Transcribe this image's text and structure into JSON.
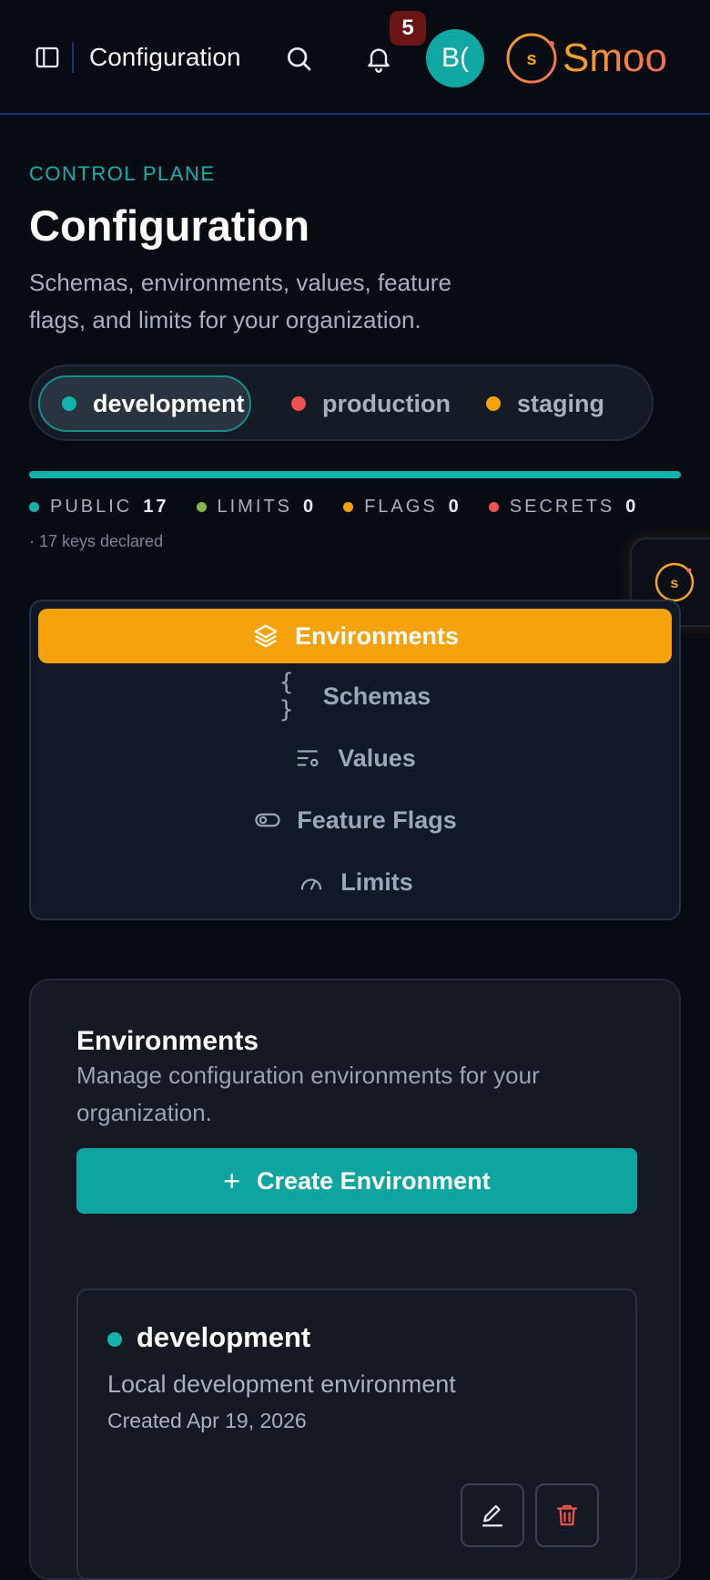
{
  "topbar": {
    "title": "Configuration",
    "notification_count": "5",
    "avatar_initials": "B(",
    "brand": "Smoo",
    "brand_mark": "s",
    "icons": [
      "sidebar-toggle-icon",
      "search-icon",
      "bell-icon"
    ]
  },
  "header": {
    "eyebrow": "CONTROL PLANE",
    "title": "Configuration",
    "description": "Schemas, environments, values, feature flags, and limits for your organization."
  },
  "environments_switcher": [
    {
      "label": "development",
      "color": "#12b3ab",
      "active": true
    },
    {
      "label": "production",
      "color": "#f05252",
      "active": false
    },
    {
      "label": "staging",
      "color": "#f5a20c",
      "active": false
    }
  ],
  "stats": {
    "progress_fraction": 1.0,
    "items": [
      {
        "label": "PUBLIC",
        "value": "17",
        "color": "#12b3ab"
      },
      {
        "label": "LIMITS",
        "value": "0",
        "color": "#84b548"
      },
      {
        "label": "FLAGS",
        "value": "0",
        "color": "#f5a20c"
      },
      {
        "label": "SECRETS",
        "value": "0",
        "color": "#f05252"
      }
    ],
    "note": "· 17 keys declared"
  },
  "floating_widget": {
    "mark": "s"
  },
  "nav": {
    "items": [
      {
        "label": "Environments",
        "icon": "layers-icon",
        "active": true
      },
      {
        "label": "Schemas",
        "icon": "braces-icon",
        "active": false
      },
      {
        "label": "Values",
        "icon": "settings-list-icon",
        "active": false
      },
      {
        "label": "Feature Flags",
        "icon": "toggle-icon",
        "active": false
      },
      {
        "label": "Limits",
        "icon": "gauge-icon",
        "active": false
      }
    ]
  },
  "environments_panel": {
    "title": "Environments",
    "description": "Manage configuration environments for your organization.",
    "create_label": "Create Environment",
    "items": [
      {
        "name": "development",
        "description": "Local development environment",
        "created": "Created Apr 19, 2026",
        "color": "#12b3ab"
      }
    ]
  },
  "colors": {
    "accent": "#12b3ab",
    "warning": "#f5a20c",
    "danger": "#f05252",
    "background": "#070b12"
  }
}
